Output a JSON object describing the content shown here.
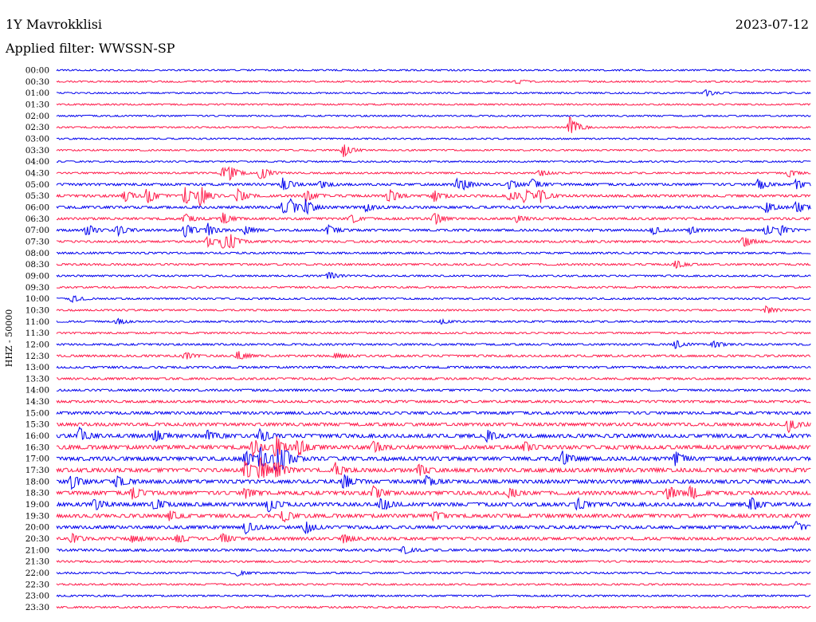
{
  "header": {
    "station": "1Y Mavrokklisi",
    "date": "2023-07-12",
    "filter": "Applied filter: WWSSN-SP"
  },
  "chart_data": {
    "type": "line",
    "title": "1Y Mavrokklisi",
    "subtitle": "Applied filter: WWSSN-SP",
    "date": "2023-07-12",
    "ylabel": "HHZ - 50000",
    "xlabel": "",
    "grid": false,
    "colors": {
      "even_trace": "#0000ee",
      "odd_trace": "#ff1a4a"
    },
    "tick_labels": [
      "00:00",
      "00:30",
      "01:00",
      "01:30",
      "02:00",
      "02:30",
      "03:00",
      "03:30",
      "04:00",
      "04:30",
      "05:00",
      "05:30",
      "06:00",
      "06:30",
      "07:00",
      "07:30",
      "08:00",
      "08:30",
      "09:00",
      "09:30",
      "10:00",
      "10:30",
      "11:00",
      "11:30",
      "12:00",
      "12:30",
      "13:00",
      "13:30",
      "14:00",
      "14:30",
      "15:00",
      "15:30",
      "16:00",
      "16:30",
      "17:00",
      "17:30",
      "18:00",
      "18:30",
      "19:00",
      "19:30",
      "20:00",
      "20:30",
      "21:00",
      "21:30",
      "22:00",
      "22:30",
      "23:00",
      "23:30"
    ],
    "noise_level": [
      0.8,
      0.8,
      0.8,
      0.8,
      0.8,
      0.8,
      0.8,
      0.8,
      0.8,
      0.9,
      1.2,
      1.3,
      1.3,
      1.2,
      1.2,
      1.1,
      1.0,
      1.0,
      0.9,
      0.9,
      0.9,
      0.9,
      0.9,
      0.9,
      1.0,
      1.1,
      1.1,
      1.1,
      1.1,
      1.2,
      1.4,
      1.6,
      1.9,
      2.0,
      2.0,
      2.0,
      1.9,
      1.9,
      1.9,
      1.8,
      1.6,
      1.5,
      1.2,
      1.0,
      0.9,
      0.9,
      0.9,
      0.9
    ],
    "events": [
      {
        "trace": 1,
        "t": 0.61,
        "amp": 3
      },
      {
        "trace": 2,
        "t": 0.86,
        "amp": 4
      },
      {
        "trace": 5,
        "t": 0.68,
        "amp": 14
      },
      {
        "trace": 7,
        "t": 0.38,
        "amp": 9
      },
      {
        "trace": 9,
        "t": 0.22,
        "amp": 8
      },
      {
        "trace": 9,
        "t": 0.23,
        "amp": 8
      },
      {
        "trace": 9,
        "t": 0.27,
        "amp": 10
      },
      {
        "trace": 9,
        "t": 0.64,
        "amp": 5
      },
      {
        "trace": 9,
        "t": 0.97,
        "amp": 5
      },
      {
        "trace": 10,
        "t": 0.3,
        "amp": 9
      },
      {
        "trace": 10,
        "t": 0.35,
        "amp": 5
      },
      {
        "trace": 10,
        "t": 0.53,
        "amp": 7
      },
      {
        "trace": 10,
        "t": 0.54,
        "amp": 4
      },
      {
        "trace": 10,
        "t": 0.6,
        "amp": 6
      },
      {
        "trace": 10,
        "t": 0.63,
        "amp": 7
      },
      {
        "trace": 10,
        "t": 0.93,
        "amp": 8
      },
      {
        "trace": 10,
        "t": 0.98,
        "amp": 6
      },
      {
        "trace": 11,
        "t": 0.09,
        "amp": 7
      },
      {
        "trace": 11,
        "t": 0.12,
        "amp": 10
      },
      {
        "trace": 11,
        "t": 0.17,
        "amp": 12
      },
      {
        "trace": 11,
        "t": 0.19,
        "amp": 14
      },
      {
        "trace": 11,
        "t": 0.24,
        "amp": 10
      },
      {
        "trace": 11,
        "t": 0.33,
        "amp": 8
      },
      {
        "trace": 11,
        "t": 0.44,
        "amp": 10
      },
      {
        "trace": 11,
        "t": 0.5,
        "amp": 7
      },
      {
        "trace": 11,
        "t": 0.6,
        "amp": 8
      },
      {
        "trace": 11,
        "t": 0.62,
        "amp": 9
      },
      {
        "trace": 11,
        "t": 0.64,
        "amp": 9
      },
      {
        "trace": 12,
        "t": 0.3,
        "amp": 9
      },
      {
        "trace": 12,
        "t": 0.31,
        "amp": 8
      },
      {
        "trace": 12,
        "t": 0.33,
        "amp": 9
      },
      {
        "trace": 12,
        "t": 0.41,
        "amp": 5
      },
      {
        "trace": 12,
        "t": 0.94,
        "amp": 7
      },
      {
        "trace": 12,
        "t": 0.98,
        "amp": 9
      },
      {
        "trace": 13,
        "t": 0.17,
        "amp": 6
      },
      {
        "trace": 13,
        "t": 0.22,
        "amp": 7
      },
      {
        "trace": 13,
        "t": 0.39,
        "amp": 6
      },
      {
        "trace": 13,
        "t": 0.5,
        "amp": 8
      },
      {
        "trace": 13,
        "t": 0.61,
        "amp": 5
      },
      {
        "trace": 14,
        "t": 0.04,
        "amp": 8
      },
      {
        "trace": 14,
        "t": 0.08,
        "amp": 7
      },
      {
        "trace": 14,
        "t": 0.17,
        "amp": 9
      },
      {
        "trace": 14,
        "t": 0.2,
        "amp": 9
      },
      {
        "trace": 14,
        "t": 0.25,
        "amp": 6
      },
      {
        "trace": 14,
        "t": 0.36,
        "amp": 6
      },
      {
        "trace": 14,
        "t": 0.79,
        "amp": 5
      },
      {
        "trace": 14,
        "t": 0.84,
        "amp": 5
      },
      {
        "trace": 14,
        "t": 0.94,
        "amp": 7
      },
      {
        "trace": 14,
        "t": 0.96,
        "amp": 6
      },
      {
        "trace": 15,
        "t": 0.2,
        "amp": 7
      },
      {
        "trace": 15,
        "t": 0.22,
        "amp": 8
      },
      {
        "trace": 15,
        "t": 0.23,
        "amp": 9
      },
      {
        "trace": 15,
        "t": 0.91,
        "amp": 8
      },
      {
        "trace": 17,
        "t": 0.82,
        "amp": 6
      },
      {
        "trace": 18,
        "t": 0.36,
        "amp": 5
      },
      {
        "trace": 20,
        "t": 0.02,
        "amp": 5
      },
      {
        "trace": 21,
        "t": 0.94,
        "amp": 6
      },
      {
        "trace": 22,
        "t": 0.08,
        "amp": 4
      },
      {
        "trace": 22,
        "t": 0.51,
        "amp": 3
      },
      {
        "trace": 24,
        "t": 0.82,
        "amp": 5
      },
      {
        "trace": 24,
        "t": 0.87,
        "amp": 5
      },
      {
        "trace": 25,
        "t": 0.17,
        "amp": 5
      },
      {
        "trace": 25,
        "t": 0.24,
        "amp": 6
      },
      {
        "trace": 25,
        "t": 0.37,
        "amp": 4
      },
      {
        "trace": 31,
        "t": 0.97,
        "amp": 9
      },
      {
        "trace": 32,
        "t": 0.03,
        "amp": 10
      },
      {
        "trace": 32,
        "t": 0.13,
        "amp": 8
      },
      {
        "trace": 32,
        "t": 0.2,
        "amp": 6
      },
      {
        "trace": 32,
        "t": 0.27,
        "amp": 9
      },
      {
        "trace": 32,
        "t": 0.57,
        "amp": 8
      },
      {
        "trace": 33,
        "t": 0.26,
        "amp": 12
      },
      {
        "trace": 33,
        "t": 0.29,
        "amp": 14
      },
      {
        "trace": 33,
        "t": 0.32,
        "amp": 12
      },
      {
        "trace": 33,
        "t": 0.42,
        "amp": 8
      },
      {
        "trace": 33,
        "t": 0.62,
        "amp": 7
      },
      {
        "trace": 34,
        "t": 0.25,
        "amp": 10
      },
      {
        "trace": 34,
        "t": 0.27,
        "amp": 14
      },
      {
        "trace": 34,
        "t": 0.29,
        "amp": 16
      },
      {
        "trace": 34,
        "t": 0.3,
        "amp": 12
      },
      {
        "trace": 34,
        "t": 0.67,
        "amp": 9
      },
      {
        "trace": 34,
        "t": 0.82,
        "amp": 8
      },
      {
        "trace": 35,
        "t": 0.25,
        "amp": 12
      },
      {
        "trace": 35,
        "t": 0.27,
        "amp": 16
      },
      {
        "trace": 35,
        "t": 0.29,
        "amp": 14
      },
      {
        "trace": 35,
        "t": 0.37,
        "amp": 9
      },
      {
        "trace": 35,
        "t": 0.48,
        "amp": 8
      },
      {
        "trace": 36,
        "t": 0.02,
        "amp": 9
      },
      {
        "trace": 36,
        "t": 0.08,
        "amp": 9
      },
      {
        "trace": 36,
        "t": 0.38,
        "amp": 10
      },
      {
        "trace": 36,
        "t": 0.49,
        "amp": 7
      },
      {
        "trace": 37,
        "t": 0.1,
        "amp": 8
      },
      {
        "trace": 37,
        "t": 0.25,
        "amp": 8
      },
      {
        "trace": 37,
        "t": 0.42,
        "amp": 8
      },
      {
        "trace": 37,
        "t": 0.6,
        "amp": 8
      },
      {
        "trace": 37,
        "t": 0.81,
        "amp": 9
      },
      {
        "trace": 37,
        "t": 0.84,
        "amp": 9
      },
      {
        "trace": 38,
        "t": 0.05,
        "amp": 8
      },
      {
        "trace": 38,
        "t": 0.13,
        "amp": 9
      },
      {
        "trace": 38,
        "t": 0.28,
        "amp": 10
      },
      {
        "trace": 38,
        "t": 0.43,
        "amp": 9
      },
      {
        "trace": 38,
        "t": 0.69,
        "amp": 8
      },
      {
        "trace": 38,
        "t": 0.92,
        "amp": 9
      },
      {
        "trace": 39,
        "t": 0.15,
        "amp": 7
      },
      {
        "trace": 39,
        "t": 0.3,
        "amp": 8
      },
      {
        "trace": 39,
        "t": 0.5,
        "amp": 7
      },
      {
        "trace": 40,
        "t": 0.25,
        "amp": 8
      },
      {
        "trace": 40,
        "t": 0.33,
        "amp": 8
      },
      {
        "trace": 40,
        "t": 0.98,
        "amp": 7
      },
      {
        "trace": 41,
        "t": 0.02,
        "amp": 6
      },
      {
        "trace": 41,
        "t": 0.1,
        "amp": 6
      },
      {
        "trace": 41,
        "t": 0.16,
        "amp": 6
      },
      {
        "trace": 41,
        "t": 0.22,
        "amp": 7
      },
      {
        "trace": 41,
        "t": 0.38,
        "amp": 6
      },
      {
        "trace": 42,
        "t": 0.46,
        "amp": 5
      },
      {
        "trace": 44,
        "t": 0.24,
        "amp": 4
      }
    ]
  }
}
